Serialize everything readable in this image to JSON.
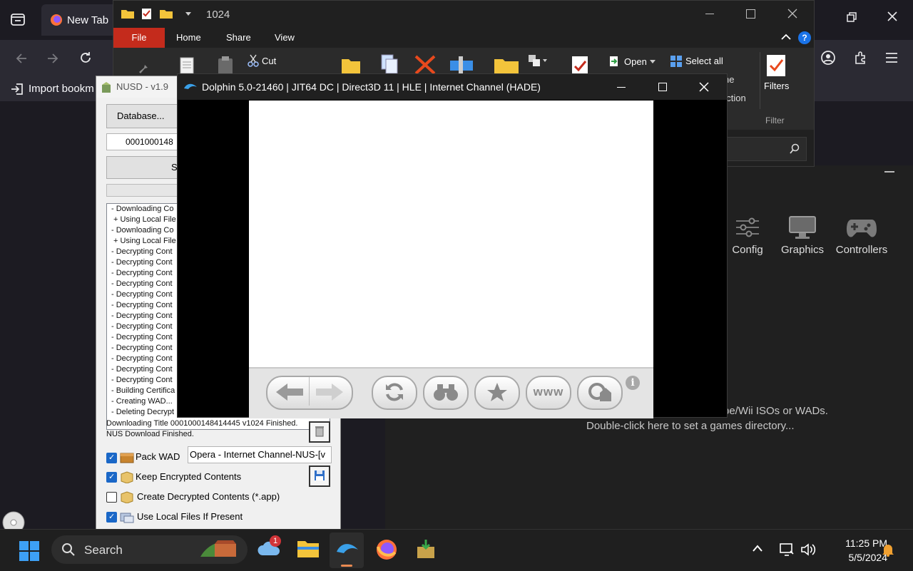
{
  "firefox": {
    "tab_title": "New Tab",
    "bookmark_import": "Import bookm"
  },
  "explorer": {
    "title": "1024",
    "tabs": {
      "file": "File",
      "home": "Home",
      "share": "Share",
      "view": "View"
    },
    "ribbon": {
      "cut": "Cut",
      "open": "Open",
      "select_all": "Select all",
      "select_none_partial": "ne",
      "invert_selection_partial": "ection",
      "filters": "Filters",
      "filter_group": "Filter"
    }
  },
  "dolphin_main": {
    "tools": [
      "Config",
      "Graphics",
      "Controllers"
    ],
    "empty_msg_1": "be/Wii ISOs or WADs.",
    "empty_msg_2": "Double-click here to set a games directory..."
  },
  "nusd": {
    "title": "NUSD - v1.9",
    "database_button": "Database...",
    "title_id": "0001000148",
    "start_button_partial": "S",
    "log_lines": [
      "- Downloading Co",
      "+ Using Local File",
      "- Downloading Co",
      "+ Using Local File",
      "- Decrypting Cont",
      "- Decrypting Cont",
      "- Decrypting Cont",
      "- Decrypting Cont",
      "- Decrypting Cont",
      "- Decrypting Cont",
      "- Decrypting Cont",
      "- Decrypting Cont",
      "- Decrypting Cont",
      "- Decrypting Cont",
      "- Decrypting Cont",
      "- Decrypting Cont",
      "- Decrypting Cont",
      "- Building Certifica",
      "- Creating WAD...",
      "- Deleting Decrypt"
    ],
    "status_1": "Downloading Title 0001000148414445 v1024 Finished.",
    "status_2": "NUS Download Finished.",
    "options": {
      "pack_wad": "Pack WAD",
      "wad_name": "Opera - Internet Channel-NUS-[v",
      "keep_encrypted": "Keep Encrypted Contents",
      "create_decrypted": "Create Decrypted Contents (*.app)",
      "use_local": "Use Local Files If Present"
    }
  },
  "dolphin_game": {
    "title": "Dolphin 5.0-21460 | JIT64 DC | Direct3D 11 | HLE | Internet Channel (HADE)",
    "www_label": "www"
  },
  "taskbar": {
    "search": "Search",
    "weather_badge": "1",
    "time": "11:25 PM",
    "date": "5/5/2024"
  }
}
